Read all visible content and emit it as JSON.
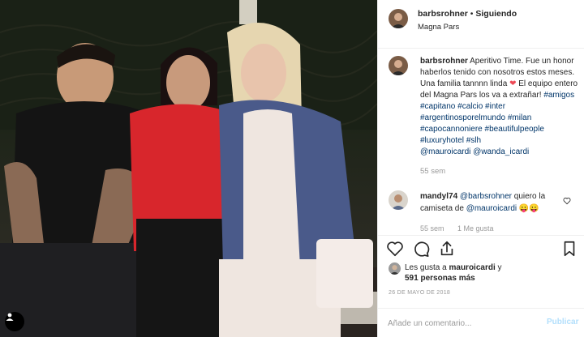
{
  "post": {
    "author": "barbsrohner",
    "separator": "•",
    "follow_status": "Siguiendo",
    "location": "Magna Pars"
  },
  "caption": {
    "username": "barbsrohner",
    "text_1": " Aperitivo Time. Fue un honor haberlos tenido con nosotros estos meses. Una familia tannnn linda ",
    "heart": "❤",
    "text_2": " El equipo entero del Magna Pars los va a extrañar! ",
    "hashtags": "#amigos #capitano #calcio #inter #argentinosporelmundo #milan #capocannoniere #beautifulpeople #luxuryhotel #slh",
    "mentions": "@mauroicardi @wanda_icardi",
    "time": "55 sem"
  },
  "comment": {
    "username": "mandyl74",
    "mention": "@barbsrohner",
    "text_1": " quiero la camiseta de ",
    "mention_2": "@mauroicardi",
    "emoji": " 😛😛",
    "time": "55 sem",
    "likes": "1 Me gusta"
  },
  "actions": {
    "like_icon": "heart-icon",
    "comment_icon": "comment-icon",
    "share_icon": "share-icon"
  },
  "likes": {
    "prefix": "Les gusta a ",
    "user": "mauroicardi",
    "suffix": " y",
    "others": "591 personas más"
  },
  "date": "26 de mayo de 2018",
  "add_comment": {
    "placeholder": "Añade un comentario...",
    "publish_label": "Publicar"
  },
  "colors": {
    "link": "#003569",
    "muted": "#999999",
    "publish_disabled": "#b2dffc",
    "heart_red": "#ed4956"
  }
}
